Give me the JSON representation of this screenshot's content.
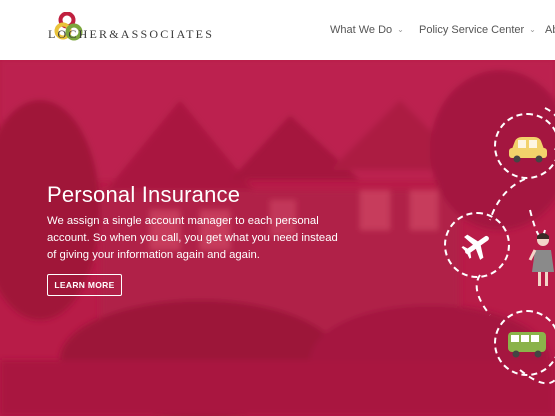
{
  "header": {
    "logo_text": "LOCHER&ASSOCIATES",
    "nav": [
      {
        "label": "What We Do"
      },
      {
        "label": "Policy Service Center"
      },
      {
        "label": "Ab"
      }
    ]
  },
  "hero": {
    "title": "Personal Insurance",
    "description": "We assign a single account manager to each personal account. So when you call, you get what you need instead of giving your information again and again.",
    "button_label": "LEARN MORE"
  },
  "icons": [
    "car-icon",
    "airplane-icon",
    "person-icon",
    "bus-icon"
  ],
  "colors": {
    "brand_red": "#b91d49",
    "logo_red": "#c0203f",
    "logo_yellow": "#e9c23a",
    "logo_green": "#7ba63c",
    "nav_text": "#555555"
  }
}
